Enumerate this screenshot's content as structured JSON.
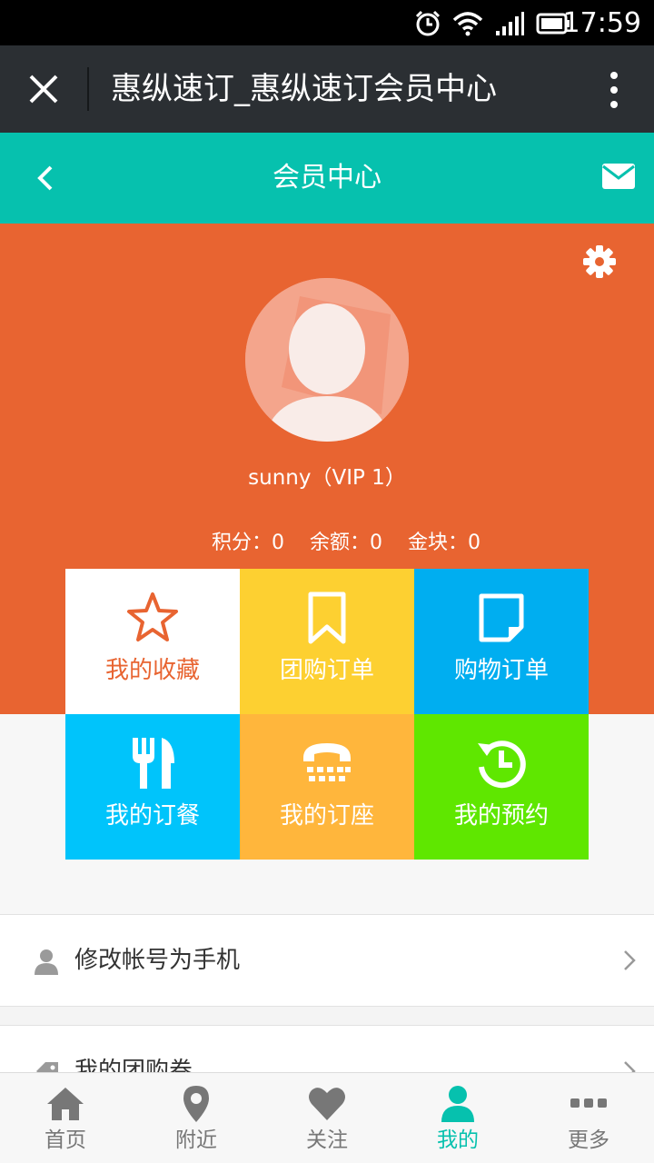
{
  "status_bar": {
    "time": "17:59"
  },
  "wechat_bar": {
    "title": "惠纵速订_惠纵速订会员中心"
  },
  "header": {
    "title": "会员中心"
  },
  "profile": {
    "name_line": "sunny（VIP 1）",
    "stats": [
      {
        "label": "积分",
        "value": "0"
      },
      {
        "label": "余额",
        "value": "0"
      },
      {
        "label": "金块",
        "value": "0"
      }
    ]
  },
  "tiles": [
    {
      "label": "我的收藏",
      "icon": "star-icon",
      "bg": "#ffffff",
      "fg": "#e86431"
    },
    {
      "label": "团购订单",
      "icon": "bookmark-icon",
      "bg": "#fdd031",
      "fg": "#ffffff"
    },
    {
      "label": "购物订单",
      "icon": "note-icon",
      "bg": "#00aef0",
      "fg": "#ffffff"
    },
    {
      "label": "我的订餐",
      "icon": "cutlery-icon",
      "bg": "#00c4fb",
      "fg": "#ffffff"
    },
    {
      "label": "我的订座",
      "icon": "phone-icon",
      "bg": "#ffb63c",
      "fg": "#ffffff"
    },
    {
      "label": "我的预约",
      "icon": "history-icon",
      "bg": "#5fe700",
      "fg": "#ffffff"
    }
  ],
  "list": [
    {
      "label": "修改帐号为手机",
      "icon": "user-icon"
    },
    {
      "label": "我的团购卷",
      "icon": "ticket-icon"
    }
  ],
  "bottom_nav": [
    {
      "label": "首页",
      "icon": "home-icon",
      "active": false
    },
    {
      "label": "附近",
      "icon": "location-pin-icon",
      "active": false
    },
    {
      "label": "关注",
      "icon": "heart-icon",
      "active": false
    },
    {
      "label": "我的",
      "icon": "person-icon",
      "active": true
    },
    {
      "label": "更多",
      "icon": "more-icon",
      "active": false
    }
  ],
  "colors": {
    "accent": "#06c1ae",
    "profile_bg": "#e86431",
    "wechat_bar": "#2b2f33"
  }
}
